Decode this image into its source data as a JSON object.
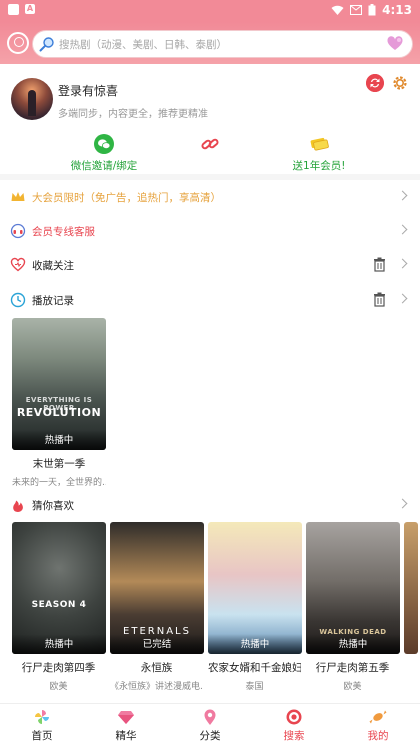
{
  "status_bar": {
    "time": "4:13"
  },
  "search": {
    "placeholder": "搜热剧（动漫、美剧、日韩、泰剧）"
  },
  "profile": {
    "title": "登录有惊喜",
    "subtitle": "多端同步，内容更全，推荐更精准"
  },
  "actions": {
    "wechat_label": "微信邀请/绑定",
    "vip_label": "送1年会员!"
  },
  "menu": {
    "vip_promo": "大会员限时（免广告，追热门，享高清）",
    "vip_service": "会员专线客服",
    "favorites": "收藏关注",
    "history": "播放记录",
    "guess": "猜你喜欢"
  },
  "history_items": [
    {
      "title": "末世第一季",
      "subtitle": "未来的一天，全世界的...",
      "tag": "热播中",
      "poster_text": "REVOLUTION"
    }
  ],
  "recommendations": [
    {
      "title": "行尸走肉第四季",
      "subtitle": "欧美",
      "tag": "热播中",
      "poster_text": "SEASON 4"
    },
    {
      "title": "永恒族",
      "subtitle": "《永恒族》讲述漫威电...",
      "tag": "已完结",
      "poster_text": "ETERNALS"
    },
    {
      "title": "农家女婿和千金娘妇",
      "subtitle": "泰国",
      "tag": "热播中",
      "poster_text": ""
    },
    {
      "title": "行尸走肉第五季",
      "subtitle": "欧美",
      "tag": "热播中",
      "poster_text": "WALKING DEAD"
    }
  ],
  "bottom_nav": [
    {
      "label": "首页",
      "color": "#333333",
      "icon": "pinwheel-icon"
    },
    {
      "label": "精华",
      "color": "#333333",
      "icon": "gem-icon"
    },
    {
      "label": "分类",
      "color": "#333333",
      "icon": "pin-icon"
    },
    {
      "label": "搜索",
      "color": "#e8454f",
      "icon": "target-icon"
    },
    {
      "label": "我的",
      "color": "#e8454f",
      "icon": "candy-icon"
    }
  ],
  "colors": {
    "accent": "#e8454f",
    "header": "#f28a97",
    "vip_text": "#e6a23c",
    "green": "#25a33a"
  }
}
